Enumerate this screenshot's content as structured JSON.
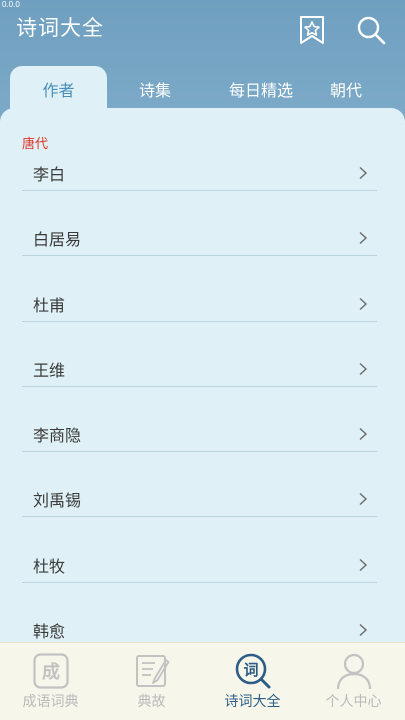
{
  "status_bar": {
    "text": "0.0.0"
  },
  "header": {
    "title": "诗词大全",
    "favorite_icon": "star-bookmark-icon",
    "search_icon": "search-icon"
  },
  "tabs": [
    {
      "label": "作者",
      "active": true
    },
    {
      "label": "诗集",
      "active": false
    },
    {
      "label": "每日精选",
      "active": false
    },
    {
      "label": "朝代",
      "active": false
    }
  ],
  "author_list": {
    "section": "唐代",
    "items": [
      {
        "name": "李白"
      },
      {
        "name": "白居易"
      },
      {
        "name": "杜甫"
      },
      {
        "name": "王维"
      },
      {
        "name": "李商隐"
      },
      {
        "name": "刘禹锡"
      },
      {
        "name": "杜牧"
      },
      {
        "name": "韩愈"
      }
    ]
  },
  "bottom_nav": {
    "items": [
      {
        "label": "成语词典",
        "icon": "idiom-dictionary-icon",
        "icon_glyph": "成",
        "active": false
      },
      {
        "label": "典故",
        "icon": "allusion-book-icon",
        "active": false
      },
      {
        "label": "诗词大全",
        "icon": "poetry-search-icon",
        "icon_glyph": "词",
        "active": true
      },
      {
        "label": "个人中心",
        "icon": "user-profile-icon",
        "active": false
      }
    ]
  },
  "colors": {
    "accent": "#4a8fb8",
    "section_header": "#e0342a",
    "active_nav": "#2c5d86",
    "panel_bg": "#dff1f6"
  }
}
